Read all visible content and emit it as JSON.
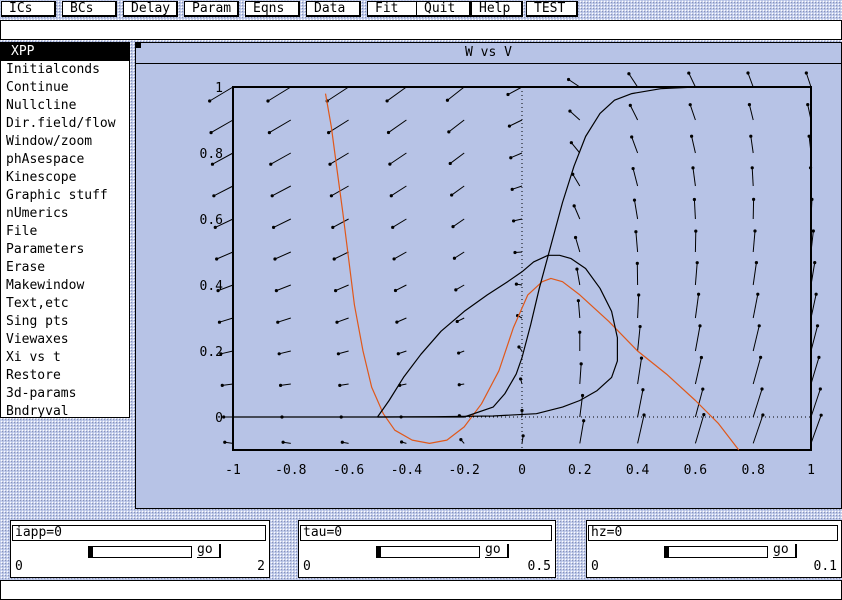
{
  "menubar": {
    "buttons": [
      "ICs",
      "BCs",
      "Delay",
      "Param",
      "Eqns",
      "Data",
      "Fit",
      "Quit",
      "Help",
      "TEST"
    ]
  },
  "command_line": {
    "value": ""
  },
  "main_menu": {
    "items": [
      "XPP",
      "Initialconds",
      "Continue",
      "Nullcline",
      "Dir.field/flow",
      "Window/zoom",
      "phAsespace",
      "Kinescope",
      "Graphic stuff",
      "nUmerics",
      "File",
      "Parameters",
      "Erase",
      "Makewindow",
      "Text,etc",
      "Sing pts",
      "Viewaxes",
      "Xi vs t",
      "Restore",
      "3d-params",
      "Bndryval"
    ],
    "selected": "XPP"
  },
  "graph": {
    "title": "W vs V",
    "colors": {
      "axes": "#000000",
      "trajectory": "#000000",
      "v_nullcline": "#e0581a",
      "w_nullcline": "#000000",
      "arrows": "#000000"
    },
    "chart_data": {
      "type": "line",
      "title": "W vs V",
      "xlabel": "",
      "ylabel": "",
      "xlim": [
        -1,
        1
      ],
      "ylim": [
        -0.1,
        1
      ],
      "x_ticks": [
        "-1",
        "-0.8",
        "-0.6",
        "-0.4",
        "-0.2",
        "0",
        "0.2",
        "0.4",
        "0.6",
        "0.8",
        "1"
      ],
      "y_ticks": [
        "0",
        "0.2",
        "0.4",
        "0.6",
        "0.8",
        "1"
      ],
      "series": [
        {
          "style": "orange",
          "points": [
            [
              -0.68,
              0.98
            ],
            [
              -0.66,
              0.88
            ],
            [
              -0.64,
              0.75
            ],
            [
              -0.62,
              0.62
            ],
            [
              -0.6,
              0.48
            ],
            [
              -0.58,
              0.34
            ],
            [
              -0.55,
              0.2
            ],
            [
              -0.52,
              0.09
            ],
            [
              -0.48,
              0.01
            ],
            [
              -0.44,
              -0.04
            ],
            [
              -0.38,
              -0.07
            ],
            [
              -0.32,
              -0.08
            ],
            [
              -0.26,
              -0.07
            ],
            [
              -0.2,
              -0.03
            ],
            [
              -0.14,
              0.04
            ],
            [
              -0.08,
              0.14
            ],
            [
              -0.03,
              0.27
            ],
            [
              0.02,
              0.37
            ],
            [
              0.07,
              0.41
            ],
            [
              0.1,
              0.42
            ],
            [
              0.14,
              0.41
            ],
            [
              0.2,
              0.37
            ],
            [
              0.3,
              0.29
            ],
            [
              0.4,
              0.2
            ],
            [
              0.5,
              0.13
            ],
            [
              0.6,
              0.05
            ],
            [
              0.68,
              -0.02
            ],
            [
              0.75,
              -0.1
            ]
          ]
        },
        {
          "style": "black",
          "points": [
            [
              -1,
              0
            ],
            [
              -0.2,
              0
            ],
            [
              -0.1,
              0.03
            ],
            [
              -0.06,
              0.07
            ],
            [
              -0.02,
              0.13
            ],
            [
              0,
              0.18
            ],
            [
              0.03,
              0.28
            ],
            [
              0.06,
              0.39
            ],
            [
              0.1,
              0.52
            ],
            [
              0.14,
              0.65
            ],
            [
              0.18,
              0.76
            ],
            [
              0.22,
              0.85
            ],
            [
              0.27,
              0.92
            ],
            [
              0.32,
              0.96
            ],
            [
              0.38,
              0.98
            ],
            [
              0.48,
              0.995
            ],
            [
              0.6,
              1
            ]
          ]
        },
        {
          "style": "black",
          "points": [
            [
              -0.5,
              0
            ],
            [
              -0.46,
              0.05
            ],
            [
              -0.41,
              0.12
            ],
            [
              -0.35,
              0.19
            ],
            [
              -0.28,
              0.26
            ],
            [
              -0.2,
              0.32
            ],
            [
              -0.12,
              0.37
            ],
            [
              -0.05,
              0.41
            ],
            [
              0,
              0.44
            ],
            [
              0.04,
              0.47
            ],
            [
              0.09,
              0.49
            ],
            [
              0.13,
              0.49
            ],
            [
              0.17,
              0.48
            ],
            [
              0.22,
              0.45
            ],
            [
              0.27,
              0.39
            ],
            [
              0.31,
              0.32
            ],
            [
              0.33,
              0.24
            ],
            [
              0.33,
              0.17
            ],
            [
              0.31,
              0.12
            ],
            [
              0.26,
              0.08
            ],
            [
              0.2,
              0.05
            ],
            [
              0.14,
              0.03
            ],
            [
              0.05,
              0.01
            ],
            [
              -0.1,
              0.003
            ],
            [
              -0.3,
              0.001
            ],
            [
              -0.5,
              0
            ]
          ]
        }
      ],
      "direction_field": {
        "x": [
          -1,
          -0.8,
          -0.6,
          -0.4,
          -0.2,
          0,
          0.2,
          0.4,
          0.6,
          0.8,
          1
        ],
        "y": [
          -0.08,
          0,
          0.1,
          0.2,
          0.3,
          0.4,
          0.5,
          0.6,
          0.7,
          0.8,
          0.9,
          1
        ]
      }
    }
  },
  "sliders": [
    {
      "label": "iapp=0",
      "go": "go",
      "min": "0",
      "max": "2",
      "position": 0
    },
    {
      "label": "tau=0",
      "go": "go",
      "min": "0",
      "max": "0.5",
      "position": 0
    },
    {
      "label": "hz=0",
      "go": "go",
      "min": "0",
      "max": "0.1",
      "position": 0
    }
  ],
  "status_line": {
    "value": ""
  }
}
